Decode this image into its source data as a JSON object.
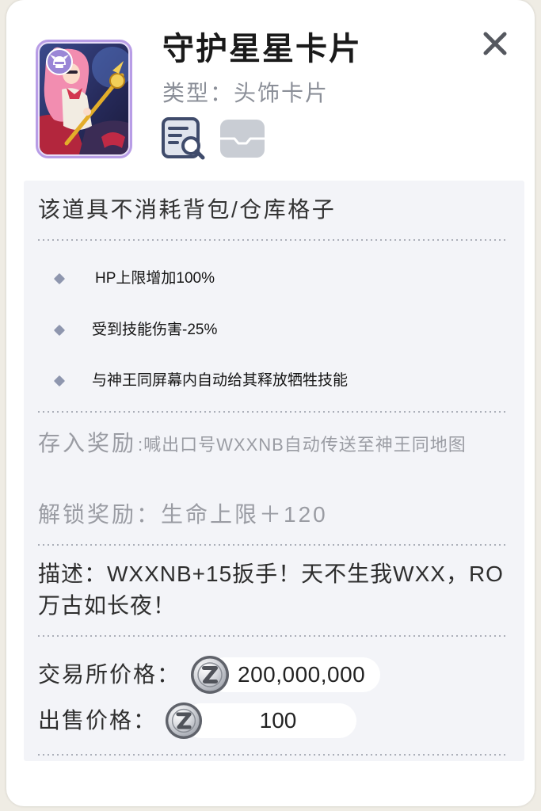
{
  "item": {
    "title": "守护星星卡片",
    "type_text": "类型：头饰卡片"
  },
  "icons": {
    "badge": "helmet-icon",
    "inspect": "search-document-icon",
    "storage": "inbox-tray-icon",
    "close": "close-icon",
    "coin": "zeny-coin-icon",
    "bullet": "diamond-bullet-icon"
  },
  "notice": "该道具不消耗背包/仓库格子",
  "effects": [
    "HP上限增加100%",
    "受到技能伤害-25%",
    "与神王同屏幕内自动给其释放牺牲技能"
  ],
  "deposit_reward": {
    "label": "存入奖励",
    "text": ":喊出口号WXXNB自动传送至神王同地图"
  },
  "unlock_reward": "解锁奖励：生命上限＋120",
  "description": [
    "描述：WXXNB+15扳手！天不生我WXX，RO",
    "万古如长夜！"
  ],
  "prices": {
    "exchange": {
      "label": "交易所价格：",
      "value": "200,000,000"
    },
    "sell": {
      "label": "出售价格：",
      "value": "100"
    }
  },
  "colors": {
    "frame": "#b89de6",
    "panel": "#f3f4f8",
    "bullet": "#8e96ae",
    "muted_text": "#9a9ca3",
    "icon_active": "#3f4b6b",
    "icon_disabled": "#c9cdd4"
  }
}
